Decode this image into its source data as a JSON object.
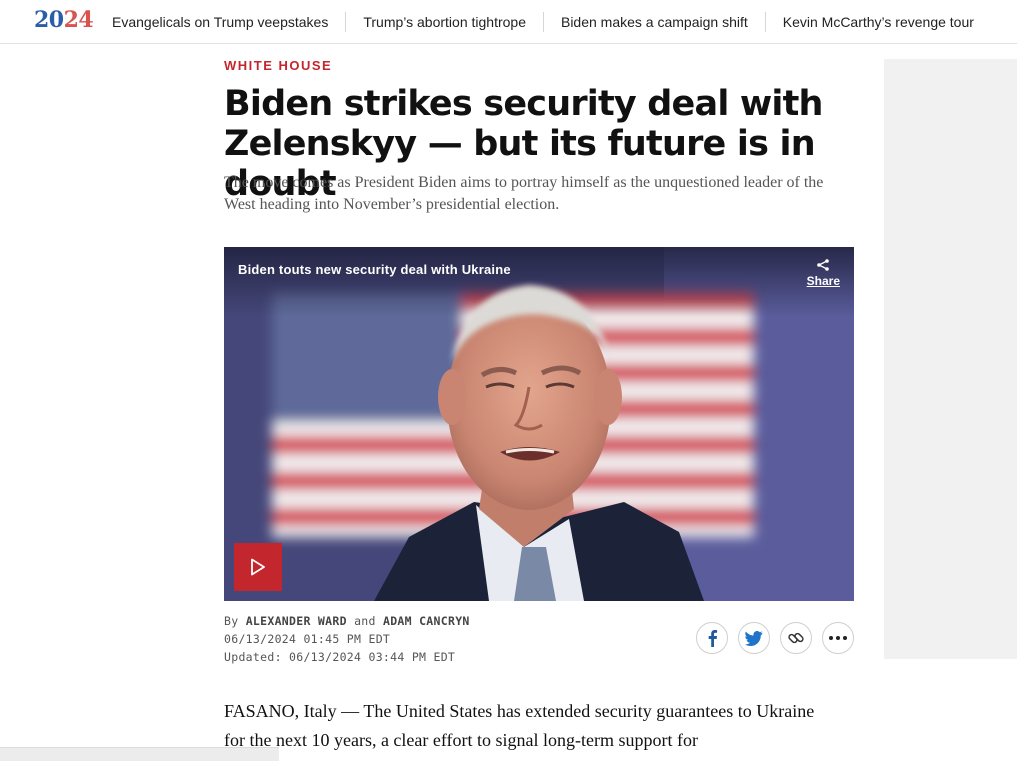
{
  "topbar": {
    "logo_part1": "20",
    "logo_part2": "24",
    "items": [
      {
        "label": "Evangelicals on Trump veepstakes"
      },
      {
        "label": "Trump’s abortion tightrope"
      },
      {
        "label": "Biden makes a campaign shift"
      },
      {
        "label": "Kevin McCarthy’s revenge tour"
      }
    ]
  },
  "article": {
    "kicker": "WHITE HOUSE",
    "headline": "Biden strikes security deal with Zelenskyy — but its future is in doubt",
    "dek": "The move comes as President Biden aims to portray himself as the unquestioned leader of the West heading into November’s presidential election.",
    "video": {
      "title": "Biden touts new security deal with Ukraine",
      "share_label": "Share"
    },
    "byline": {
      "by": "By",
      "author1": "ALEXANDER WARD",
      "and": "and",
      "author2": "ADAM CANCRYN",
      "published": "06/13/2024 01:45 PM EDT",
      "updated": "Updated: 06/13/2024 03:44 PM EDT"
    },
    "body": "FASANO, Italy — The United States has extended security guarantees to Ukraine for the next 10 years, a clear effort to signal long-term support for"
  },
  "icons": {
    "facebook": "facebook-icon",
    "twitter": "twitter-icon",
    "link": "link-icon",
    "more": "more-icon",
    "play": "play-icon",
    "share": "share-icon"
  },
  "colors": {
    "accent": "#c4262e",
    "facebook": "#1f5a9e",
    "twitter": "#1d74c8",
    "logo_blue": "#2a5ea8",
    "logo_red": "#d9534f"
  }
}
